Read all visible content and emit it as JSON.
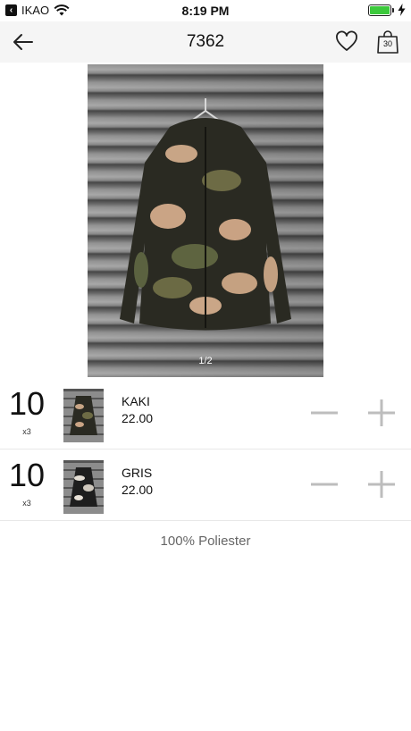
{
  "status_bar": {
    "carrier": "IKAO",
    "time": "8:19 PM",
    "icons": [
      "back-to-app-icon",
      "wifi-icon",
      "battery-icon",
      "charging-bolt-icon"
    ],
    "battery_color": "#3cc93c"
  },
  "navbar": {
    "title": "7362",
    "icons": [
      "back-arrow-icon",
      "heart-icon",
      "shopping-bag-icon"
    ],
    "bag_count": "30"
  },
  "product_image": {
    "pager": "1/2"
  },
  "variants": [
    {
      "quantity": "10",
      "multiplier": "x3",
      "color": "KAKI",
      "price": "22.00"
    },
    {
      "quantity": "10",
      "multiplier": "x3",
      "color": "GRIS",
      "price": "22.00"
    }
  ],
  "material": "100% Poliester",
  "colors": {
    "stepper_gray": "#bdbdbd",
    "divider": "#e8e8e8",
    "navbar_bg": "#f5f5f5"
  }
}
